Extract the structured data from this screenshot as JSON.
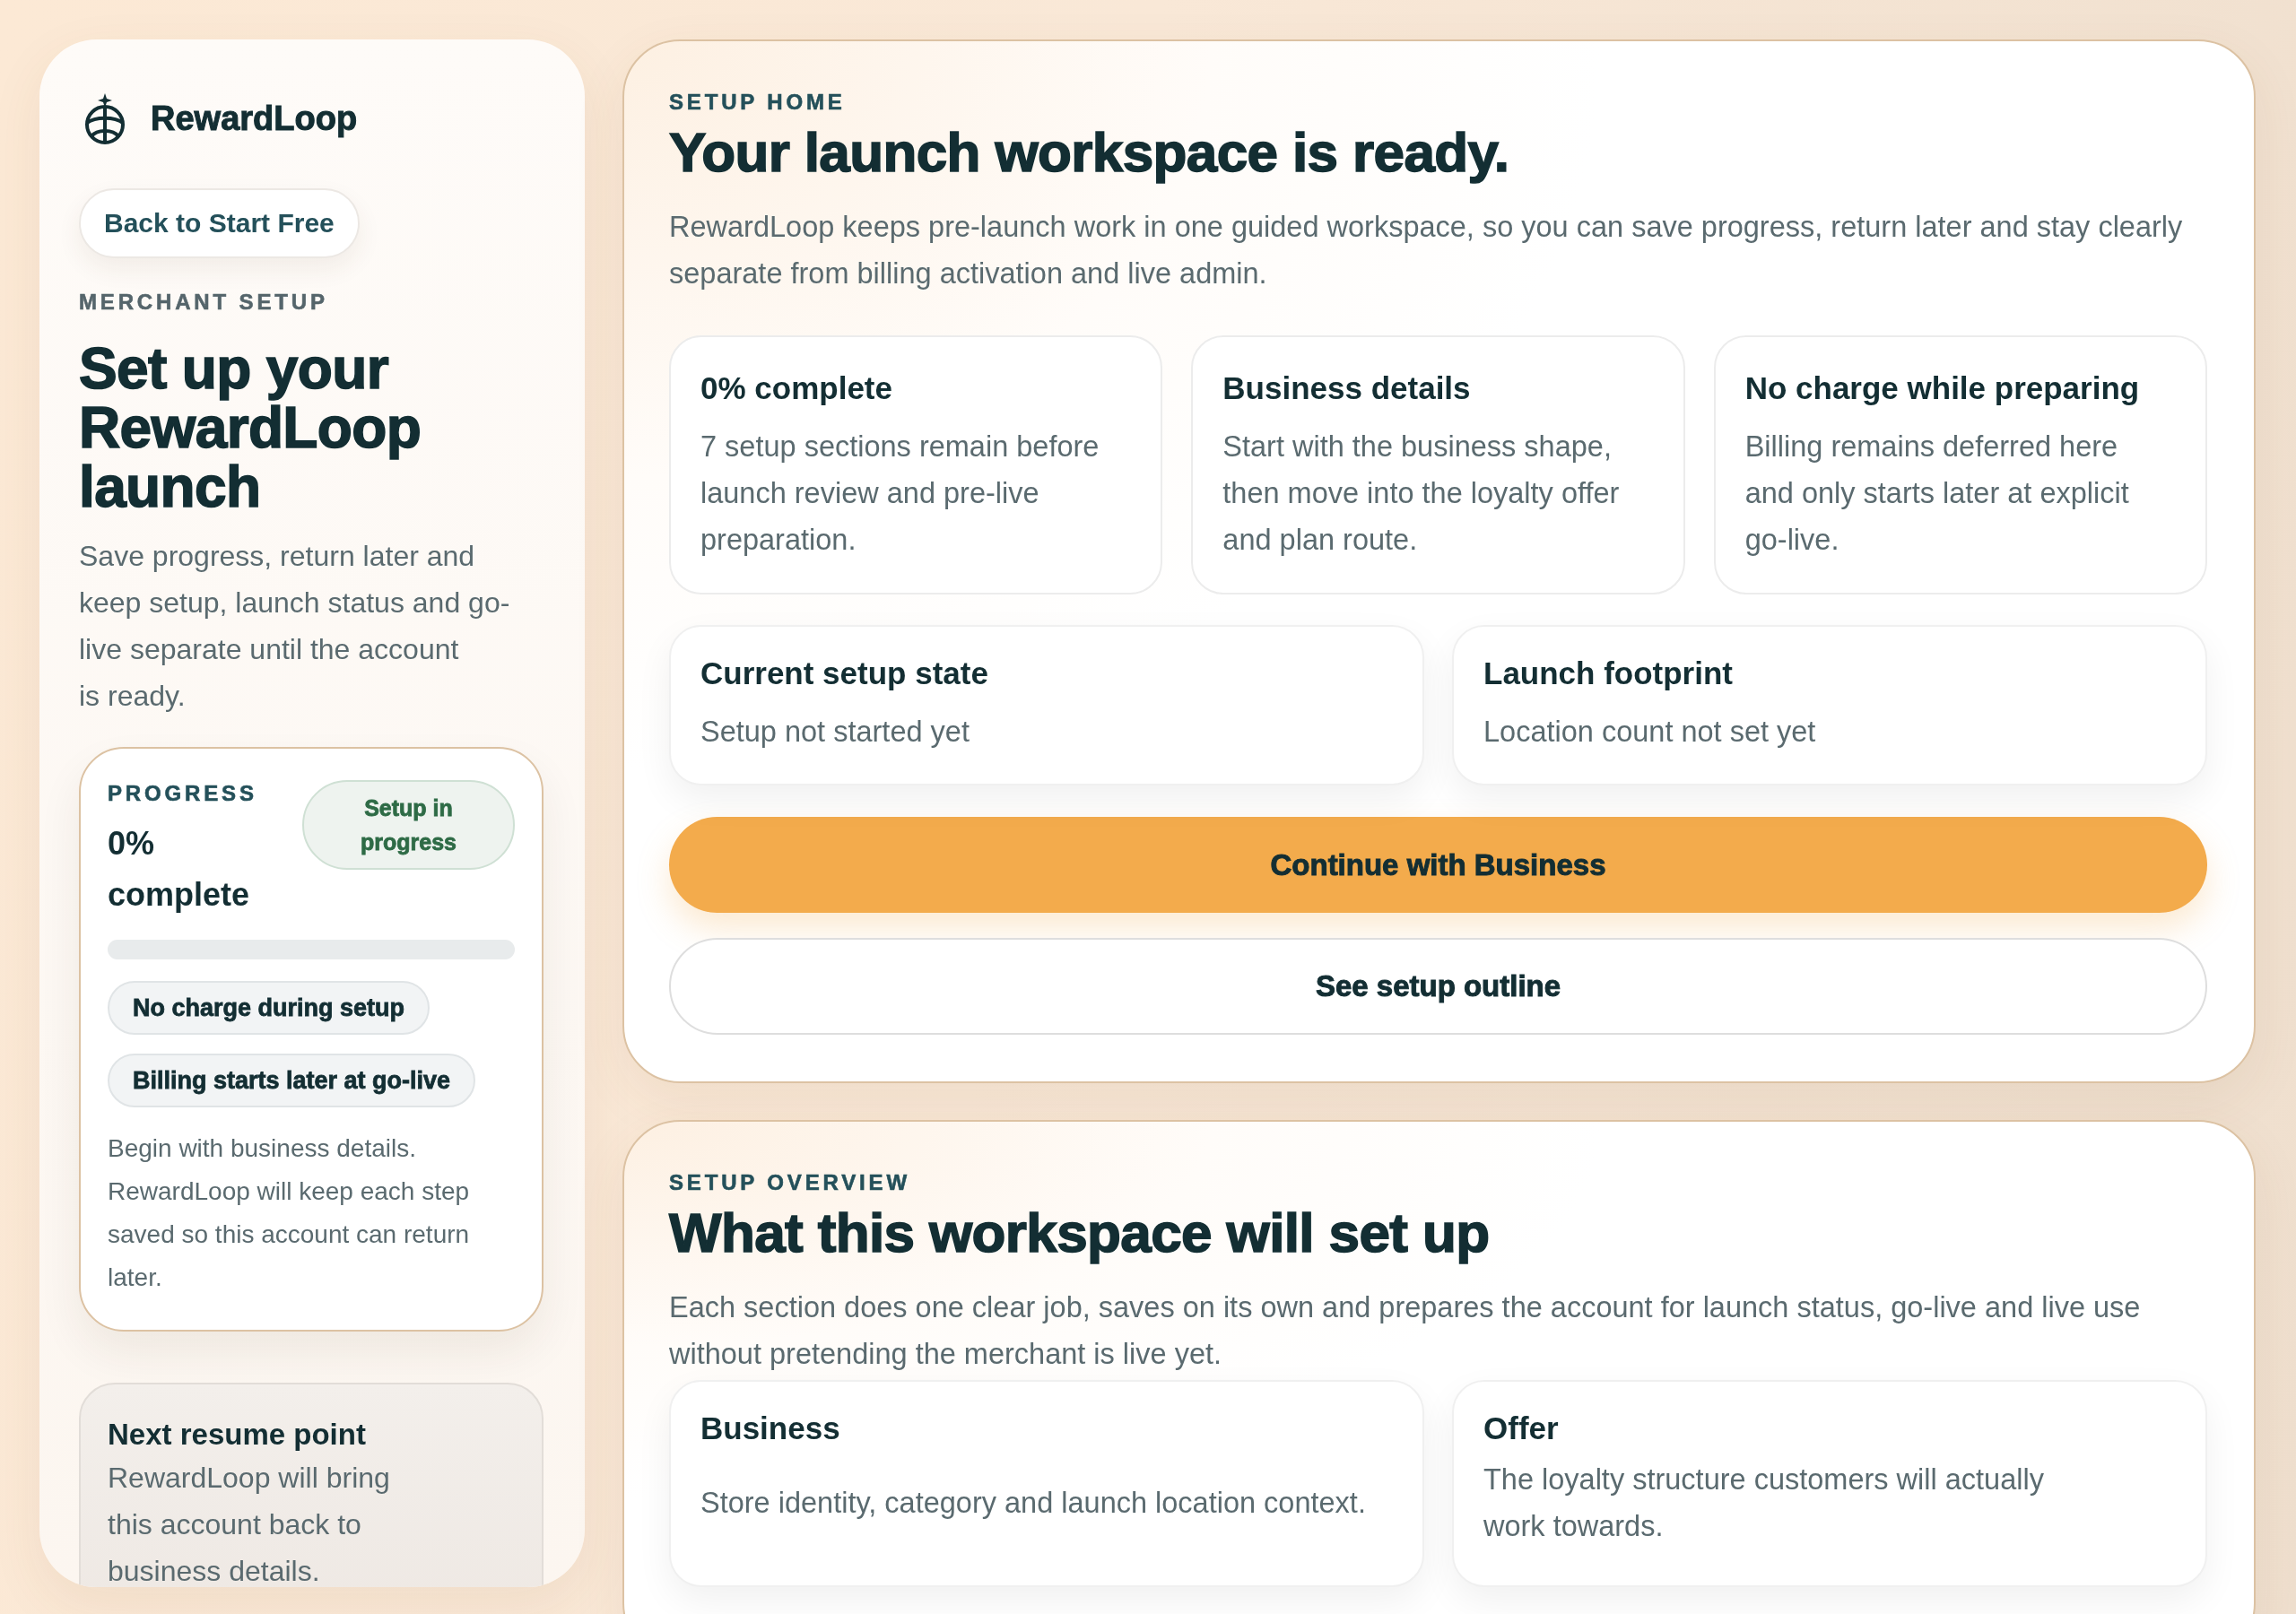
{
  "sidebar": {
    "brand": {
      "name": "RewardLoop"
    },
    "back_button": "Back to Start Free",
    "eyebrow": "MERCHANT SETUP",
    "title": "Set up your RewardLoop launch",
    "description": "Save progress, return later and keep setup, launch status and go-live separate until the account is ready.",
    "progress_card": {
      "label": "PROGRESS",
      "value": "0% complete",
      "status_badge": "Setup in progress",
      "level": 0,
      "chips": [
        "No charge during setup",
        "Billing starts later at go-live"
      ],
      "note": "Begin with business details. RewardLoop will keep each step saved so this account can return later."
    },
    "resume_card": {
      "title": "Next resume point",
      "text": "RewardLoop will bring this account back to business details."
    }
  },
  "setup_home": {
    "eyebrow": "SETUP HOME",
    "title": "Your launch workspace is ready.",
    "description": "RewardLoop keeps pre-launch work in one guided workspace, so you can save progress, return later and stay clearly separate from billing activation and live admin.",
    "summary_cards": [
      {
        "title": "0% complete",
        "text": "7 setup sections remain before launch review and pre-live preparation."
      },
      {
        "title": "Business details",
        "text": "Start with the business shape, then move into the loyalty offer and plan route."
      },
      {
        "title": "No charge while preparing",
        "text": "Billing remains deferred here and only starts later at explicit go-live."
      }
    ],
    "state_cards": [
      {
        "title": "Current setup state",
        "text": "Setup not started yet"
      },
      {
        "title": "Launch footprint",
        "text": "Location count not set yet"
      }
    ],
    "primary_button": "Continue with Business",
    "secondary_button": "See setup outline"
  },
  "setup_overview": {
    "eyebrow": "SETUP OVERVIEW",
    "title": "What this workspace will set up",
    "description": "Each section does one clear job, saves on its own and prepares the account for launch status, go-live and live use without pretending the merchant is live yet.",
    "sections": [
      {
        "title": "Business",
        "text": "Store identity, category and launch location context."
      },
      {
        "title": "Offer",
        "text": "The loyalty structure customers will actually work towards."
      }
    ]
  }
}
